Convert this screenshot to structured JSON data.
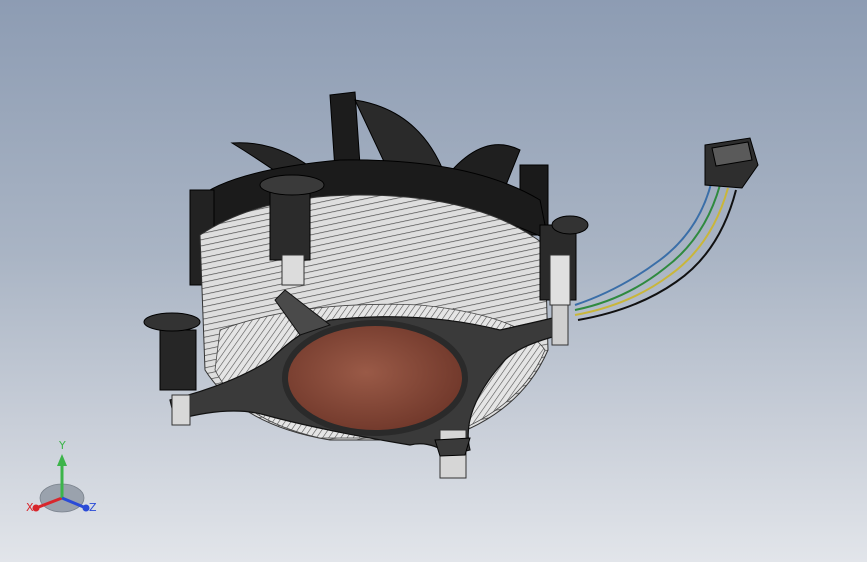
{
  "triad": {
    "x_label": "X",
    "y_label": "Y",
    "z_label": "Z",
    "x_color": "#d8262c",
    "y_color": "#3cb44a",
    "z_color": "#2a4bd7"
  },
  "model": {
    "icon": "cpu-cooler-model",
    "copper_color": "#8a4a3a",
    "fin_color": "#d7d7d7",
    "frame_color": "#2a2a2a",
    "wire_colors": [
      "#3a6ea8",
      "#2f8a3f",
      "#c9b63a",
      "#111111"
    ]
  }
}
